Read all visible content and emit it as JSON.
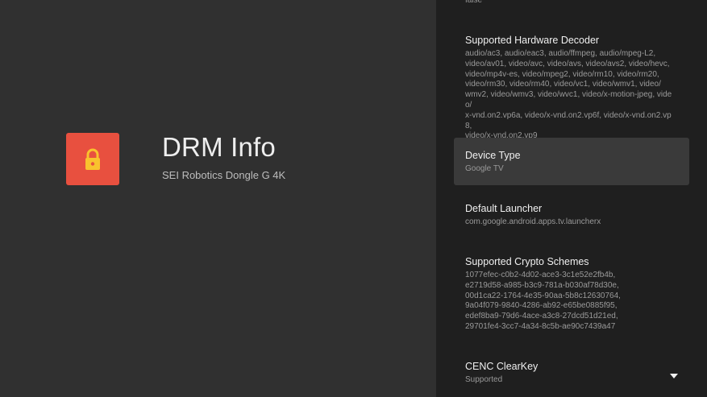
{
  "app": {
    "title": "DRM Info",
    "subtitle": "SEI Robotics Dongle G 4K",
    "icon": "lock-icon",
    "icon_bg_color": "#e8503f",
    "icon_fg_color": "#f9c22e"
  },
  "list": {
    "top_partial_value": "false",
    "items": [
      {
        "title": "Supported Hardware Decoder",
        "value": "audio/ac3, audio/eac3, audio/ffmpeg, audio/mpeg-L2,\nvideo/av01, video/avc, video/avs, video/avs2, video/hevc,\nvideo/mp4v-es, video/mpeg2, video/rm10, video/rm20,\nvideo/rm30, video/rm40, video/vc1, video/wmv1, video/\nwmv2, video/wmv3, video/wvc1, video/x-motion-jpeg, video/\nx-vnd.on2.vp6a, video/x-vnd.on2.vp6f, video/x-vnd.on2.vp8,\nvideo/x-vnd.on2.vp9"
      },
      {
        "title": "Device Type",
        "value": "Google TV"
      },
      {
        "title": "Default Launcher",
        "value": "com.google.android.apps.tv.launcherx"
      },
      {
        "title": "Supported Crypto Schemes",
        "value": "1077efec-c0b2-4d02-ace3-3c1e52e2fb4b,\ne2719d58-a985-b3c9-781a-b030af78d30e,\n00d1ca22-1764-4e35-90aa-5b8c12630764,\n9a04f079-9840-4286-ab92-e65be0885f95,\nedef8ba9-79d6-4ace-a3c8-27dcd51d21ed,\n29701fe4-3cc7-4a34-8c5b-ae90c7439a47"
      },
      {
        "title": "CENC ClearKey",
        "value": "Supported"
      }
    ]
  }
}
